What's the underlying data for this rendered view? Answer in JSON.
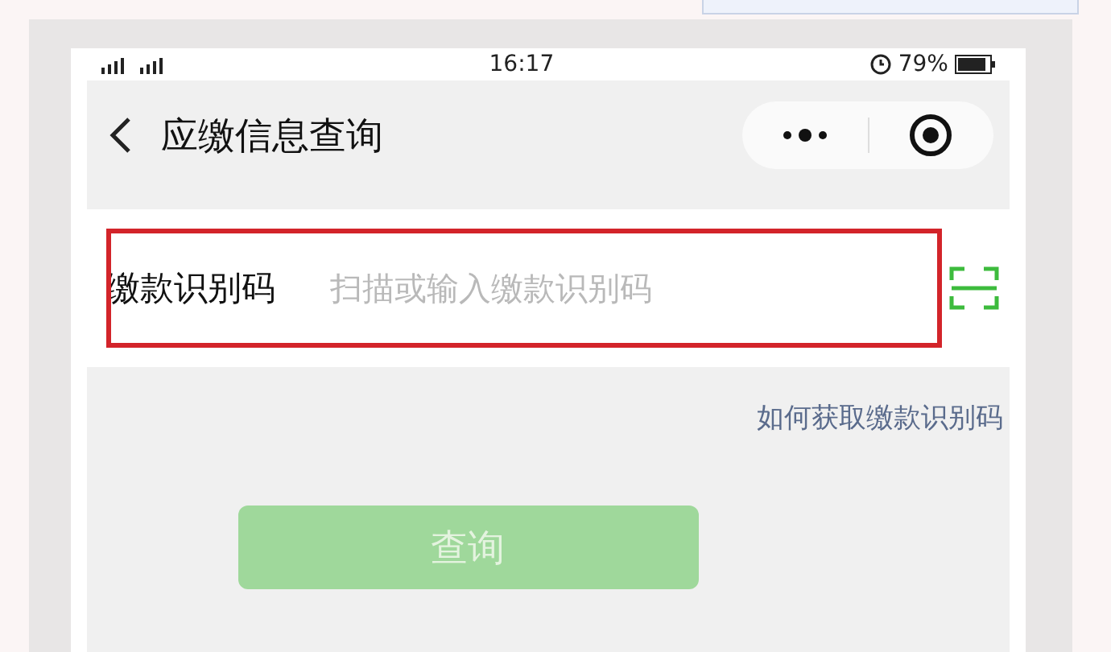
{
  "status_bar": {
    "time": "16:17",
    "battery": "79%"
  },
  "nav": {
    "title": "应缴信息查询"
  },
  "form": {
    "label": "缴款识别码",
    "placeholder": "扫描或输入缴款识别码",
    "highlighted": true
  },
  "help_link": "如何获取缴款识别码",
  "query_button": {
    "label": "查询",
    "disabled": true
  }
}
